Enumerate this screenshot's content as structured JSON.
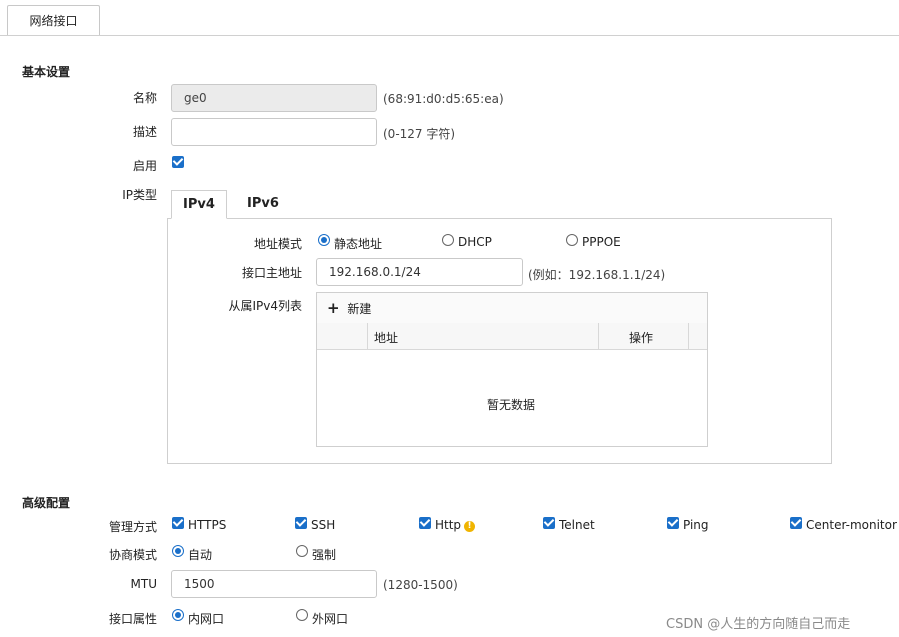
{
  "tab": {
    "label": "网络接口"
  },
  "basic": {
    "title": "基本设置",
    "name_label": "名称",
    "name_value": "ge0",
    "name_hint": "(68:91:d0:d5:65:ea)",
    "desc_label": "描述",
    "desc_value": "",
    "desc_hint": "(0-127 字符)",
    "enable_label": "启用",
    "enable_checked": true,
    "iptype_label": "IP类型"
  },
  "ip": {
    "tabs": [
      {
        "label": "IPv4",
        "active": true
      },
      {
        "label": "IPv6",
        "active": false
      }
    ],
    "mode_label": "地址模式",
    "modes": [
      {
        "label": "静态地址",
        "selected": true
      },
      {
        "label": "DHCP",
        "selected": false
      },
      {
        "label": "PPPOE",
        "selected": false
      }
    ],
    "primary_label": "接口主地址",
    "primary_value": "192.168.0.1/24",
    "primary_hint": "(例如：192.168.1.1/24)",
    "secondary_label": "从属IPv4列表",
    "add_icon": "plus-icon",
    "add_label": "新建",
    "columns": [
      "地址",
      "操作"
    ],
    "empty_text": "暂无数据"
  },
  "advanced": {
    "title": "高级配置",
    "mgmt_label": "管理方式",
    "mgmt": [
      {
        "label": "HTTPS",
        "checked": true
      },
      {
        "label": "SSH",
        "checked": true
      },
      {
        "label": "Http",
        "checked": true,
        "warning": "!"
      },
      {
        "label": "Telnet",
        "checked": true
      },
      {
        "label": "Ping",
        "checked": true
      },
      {
        "label": "Center-monitor",
        "checked": true
      }
    ],
    "nego_label": "协商模式",
    "nego": [
      {
        "label": "自动",
        "selected": true
      },
      {
        "label": "强制",
        "selected": false
      }
    ],
    "mtu_label": "MTU",
    "mtu_value": "1500",
    "mtu_hint": "(1280-1500)",
    "attr_label": "接口属性",
    "attr": [
      {
        "label": "内网口",
        "selected": true
      },
      {
        "label": "外网口",
        "selected": false
      }
    ]
  },
  "watermark": "CSDN @人生的方向随自己而走",
  "colors": {
    "accent": "#1a6fc9",
    "warning": "#f0b400"
  }
}
